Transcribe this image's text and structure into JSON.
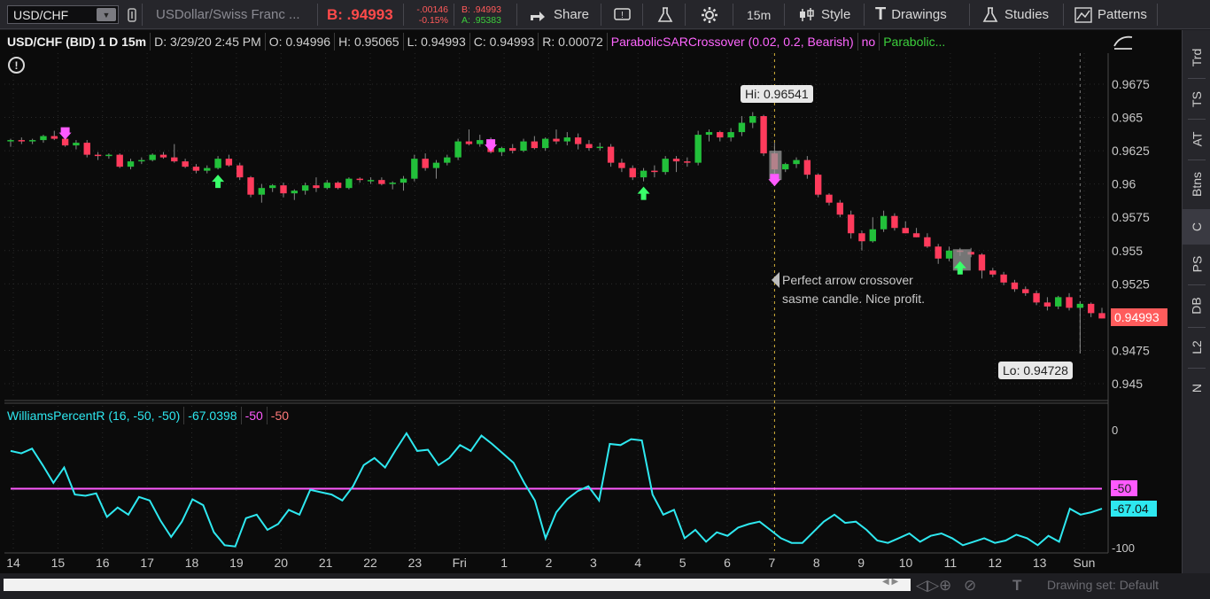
{
  "toolbar": {
    "symbol": "USD/CHF",
    "description": "USDollar/Swiss Franc ...",
    "bid_label": "B: .94993",
    "change_abs": "-.00146",
    "change_pct": "-0.15%",
    "bid_small": "B: .94993",
    "ask_small": "A: .95383",
    "share_label": "Share",
    "interval_label": "15m",
    "style_label": "Style",
    "drawings_label": "Drawings",
    "studies_label": "Studies",
    "patterns_label": "Patterns"
  },
  "infobar": {
    "symbol": "USD/CHF (BID) 1 D 15m",
    "date": "D: 3/29/20 2:45 PM",
    "open": "O: 0.94996",
    "high": "H: 0.95065",
    "low": "L: 0.94993",
    "close": "C: 0.94993",
    "range": "R: 0.00072",
    "study": "ParabolicSARCrossover (0.02, 0.2, Bearish)",
    "study_flag": "no",
    "study2": "Parabolic..."
  },
  "annotations": {
    "hi": "Hi: 0.96541",
    "lo": "Lo: 0.94728",
    "note_line1": "Perfect arrow crossover",
    "note_line2": "sasme candle. Nice profit.",
    "last_price": "0.94993"
  },
  "indicator": {
    "name": "WilliamsPercentR (16, -50, -50)",
    "value": "-67.0398",
    "level1": "-50",
    "level2": "-50",
    "tag_level": "-50",
    "tag_value": "-67.04"
  },
  "side_tabs": [
    "Trd",
    "TS",
    "AT",
    "Btns",
    "C",
    "PS",
    "DB",
    "L2",
    "N"
  ],
  "bottom": {
    "drawing_set": "Drawing set: Default"
  },
  "colors": {
    "up": "#22c03a",
    "down": "#ff3b5c",
    "williams": "#2ee8f0",
    "level": "#ff5aff",
    "arrow_down": "#ff5aff",
    "arrow_up": "#39ff6a"
  },
  "chart_data": {
    "type": "candlestick",
    "price_axis": {
      "min": 0.945,
      "max": 0.9675,
      "ticks": [
        "0.9675",
        "0.965",
        "0.9625",
        "0.96",
        "0.9575",
        "0.955",
        "0.9525",
        "0.9475",
        "0.945"
      ]
    },
    "x_ticks": [
      "14",
      "15",
      "16",
      "17",
      "18",
      "19",
      "20",
      "21",
      "22",
      "23",
      "Fri",
      "1",
      "2",
      "3",
      "4",
      "5",
      "6",
      "7",
      "8",
      "9",
      "10",
      "11",
      "12",
      "13",
      "Sun"
    ],
    "candles": [
      [
        0.9632,
        0.9634,
        0.9628,
        0.9633
      ],
      [
        0.9633,
        0.9635,
        0.963,
        0.9632
      ],
      [
        0.9632,
        0.9634,
        0.963,
        0.9633
      ],
      [
        0.9633,
        0.9637,
        0.9631,
        0.9636
      ],
      [
        0.9636,
        0.964,
        0.9633,
        0.9634
      ],
      [
        0.9634,
        0.9636,
        0.9628,
        0.9629
      ],
      [
        0.9629,
        0.9633,
        0.9626,
        0.9631
      ],
      [
        0.9631,
        0.9633,
        0.962,
        0.9622
      ],
      [
        0.9622,
        0.9624,
        0.9618,
        0.9621
      ],
      [
        0.9621,
        0.9623,
        0.9619,
        0.9622
      ],
      [
        0.9622,
        0.9623,
        0.9612,
        0.9613
      ],
      [
        0.9613,
        0.9619,
        0.9611,
        0.9617
      ],
      [
        0.9617,
        0.962,
        0.9615,
        0.9618
      ],
      [
        0.9618,
        0.9623,
        0.9617,
        0.9622
      ],
      [
        0.9622,
        0.9624,
        0.9619,
        0.962
      ],
      [
        0.962,
        0.963,
        0.9616,
        0.9617
      ],
      [
        0.9617,
        0.9619,
        0.9612,
        0.9613
      ],
      [
        0.9613,
        0.9615,
        0.9608,
        0.961
      ],
      [
        0.961,
        0.9614,
        0.9608,
        0.9612
      ],
      [
        0.9612,
        0.9621,
        0.9611,
        0.9619
      ],
      [
        0.9619,
        0.9622,
        0.9613,
        0.9614
      ],
      [
        0.9614,
        0.9616,
        0.9603,
        0.9605
      ],
      [
        0.9605,
        0.9606,
        0.959,
        0.9592
      ],
      [
        0.9592,
        0.96,
        0.9586,
        0.9597
      ],
      [
        0.9597,
        0.96,
        0.9594,
        0.9599
      ],
      [
        0.9599,
        0.9601,
        0.959,
        0.9593
      ],
      [
        0.9593,
        0.9596,
        0.9588,
        0.9595
      ],
      [
        0.9595,
        0.9601,
        0.9592,
        0.9599
      ],
      [
        0.9599,
        0.9605,
        0.9594,
        0.9597
      ],
      [
        0.9597,
        0.9603,
        0.9596,
        0.9601
      ],
      [
        0.9601,
        0.9602,
        0.9596,
        0.9597
      ],
      [
        0.9597,
        0.9605,
        0.9596,
        0.9604
      ],
      [
        0.9604,
        0.9605,
        0.9601,
        0.9603
      ],
      [
        0.9603,
        0.9605,
        0.96,
        0.9603
      ],
      [
        0.9603,
        0.9605,
        0.9599,
        0.96
      ],
      [
        0.96,
        0.9602,
        0.9596,
        0.9601
      ],
      [
        0.9601,
        0.9606,
        0.9595,
        0.9604
      ],
      [
        0.9604,
        0.9622,
        0.9602,
        0.9619
      ],
      [
        0.9619,
        0.9623,
        0.961,
        0.9612
      ],
      [
        0.9612,
        0.9618,
        0.9604,
        0.9616
      ],
      [
        0.9616,
        0.9622,
        0.9614,
        0.962
      ],
      [
        0.962,
        0.9634,
        0.9618,
        0.9632
      ],
      [
        0.9632,
        0.9641,
        0.9629,
        0.963
      ],
      [
        0.963,
        0.9637,
        0.9628,
        0.9633
      ],
      [
        0.9633,
        0.9635,
        0.9623,
        0.9624
      ],
      [
        0.9624,
        0.9628,
        0.9621,
        0.9627
      ],
      [
        0.9627,
        0.963,
        0.9623,
        0.9625
      ],
      [
        0.9625,
        0.9634,
        0.9624,
        0.9632
      ],
      [
        0.9632,
        0.9636,
        0.9626,
        0.9627
      ],
      [
        0.9627,
        0.9635,
        0.9625,
        0.9634
      ],
      [
        0.9634,
        0.9641,
        0.963,
        0.9632
      ],
      [
        0.9632,
        0.9639,
        0.9629,
        0.9635
      ],
      [
        0.9635,
        0.9638,
        0.9626,
        0.963
      ],
      [
        0.963,
        0.9633,
        0.9625,
        0.9627
      ],
      [
        0.9627,
        0.9631,
        0.9625,
        0.9628
      ],
      [
        0.9628,
        0.963,
        0.9613,
        0.9616
      ],
      [
        0.9616,
        0.9619,
        0.9609,
        0.9612
      ],
      [
        0.9612,
        0.9614,
        0.9603,
        0.9605
      ],
      [
        0.9605,
        0.9612,
        0.9602,
        0.961
      ],
      [
        0.961,
        0.9614,
        0.9605,
        0.9609
      ],
      [
        0.9609,
        0.9621,
        0.9607,
        0.9619
      ],
      [
        0.9619,
        0.9621,
        0.9609,
        0.9617
      ],
      [
        0.9617,
        0.962,
        0.9613,
        0.9616
      ],
      [
        0.9616,
        0.964,
        0.9614,
        0.9637
      ],
      [
        0.9637,
        0.9641,
        0.9632,
        0.9639
      ],
      [
        0.9639,
        0.964,
        0.9632,
        0.9635
      ],
      [
        0.9635,
        0.9642,
        0.9632,
        0.9639
      ],
      [
        0.9639,
        0.9651,
        0.9636,
        0.9646
      ],
      [
        0.9646,
        0.9654,
        0.9642,
        0.9651
      ],
      [
        0.9651,
        0.9652,
        0.9621,
        0.9623
      ],
      [
        0.9623,
        0.9631,
        0.9608,
        0.9611
      ],
      [
        0.9611,
        0.9616,
        0.9609,
        0.9615
      ],
      [
        0.9615,
        0.962,
        0.9612,
        0.9618
      ],
      [
        0.9618,
        0.9621,
        0.9604,
        0.9607
      ],
      [
        0.9607,
        0.9608,
        0.959,
        0.9592
      ],
      [
        0.9592,
        0.9593,
        0.9584,
        0.9586
      ],
      [
        0.9586,
        0.9588,
        0.9575,
        0.9577
      ],
      [
        0.9577,
        0.958,
        0.9559,
        0.9563
      ],
      [
        0.9563,
        0.9565,
        0.955,
        0.9557
      ],
      [
        0.9557,
        0.9575,
        0.9556,
        0.9566
      ],
      [
        0.9566,
        0.958,
        0.9564,
        0.9576
      ],
      [
        0.9576,
        0.9578,
        0.9565,
        0.9567
      ],
      [
        0.9567,
        0.9572,
        0.9563,
        0.9563
      ],
      [
        0.9563,
        0.9567,
        0.956,
        0.956
      ],
      [
        0.956,
        0.9563,
        0.9552,
        0.9553
      ],
      [
        0.9553,
        0.9555,
        0.954,
        0.9544
      ],
      [
        0.9544,
        0.9553,
        0.9542,
        0.955
      ],
      [
        0.955,
        0.9552,
        0.9546,
        0.9549
      ],
      [
        0.9549,
        0.9552,
        0.9545,
        0.9547
      ],
      [
        0.9547,
        0.9548,
        0.9529,
        0.9535
      ],
      [
        0.9535,
        0.9537,
        0.953,
        0.9532
      ],
      [
        0.9532,
        0.9534,
        0.9524,
        0.9526
      ],
      [
        0.9526,
        0.9528,
        0.9519,
        0.9521
      ],
      [
        0.9521,
        0.9523,
        0.9516,
        0.9518
      ],
      [
        0.9518,
        0.952,
        0.9509,
        0.9511
      ],
      [
        0.9511,
        0.9515,
        0.9505,
        0.9508
      ],
      [
        0.9508,
        0.9516,
        0.9506,
        0.9515
      ],
      [
        0.9515,
        0.9518,
        0.9505,
        0.9507
      ],
      [
        0.9507,
        0.9512,
        0.9473,
        0.951
      ],
      [
        0.951,
        0.9511,
        0.95,
        0.9503
      ],
      [
        0.9503,
        0.9507,
        0.9499,
        0.9499
      ]
    ],
    "arrows_down": [
      5,
      44,
      70
    ],
    "arrows_up": [
      19,
      58,
      87
    ],
    "williams": [
      -18,
      -20,
      -16,
      -30,
      -45,
      -32,
      -55,
      -56,
      -54,
      -74,
      -66,
      -72,
      -57,
      -60,
      -77,
      -91,
      -78,
      -59,
      -64,
      -87,
      -98,
      -99,
      -75,
      -72,
      -85,
      -80,
      -68,
      -72,
      -51,
      -53,
      -55,
      -60,
      -48,
      -30,
      -24,
      -32,
      -17,
      -3,
      -18,
      -17,
      -30,
      -24,
      -13,
      -18,
      -5,
      -12,
      -20,
      -28,
      -45,
      -60,
      -92,
      -70,
      -59,
      -52,
      -48,
      -60,
      -12,
      -13,
      -8,
      -9,
      -55,
      -72,
      -68,
      -92,
      -85,
      -95,
      -87,
      -90,
      -83,
      -80,
      -78,
      -85,
      -92,
      -96,
      -96,
      -87,
      -78,
      -72,
      -79,
      -78,
      -85,
      -94,
      -96,
      -92,
      -88,
      -95,
      -90,
      -88,
      -92,
      -98,
      -95,
      -92,
      -96,
      -94,
      -89,
      -92,
      -98,
      -90,
      -95,
      -67,
      -72,
      -70,
      -67
    ],
    "williams_axis": {
      "min": -100,
      "max": 0,
      "ticks": [
        "0",
        "-100"
      ]
    },
    "crosshair_index": 70
  }
}
